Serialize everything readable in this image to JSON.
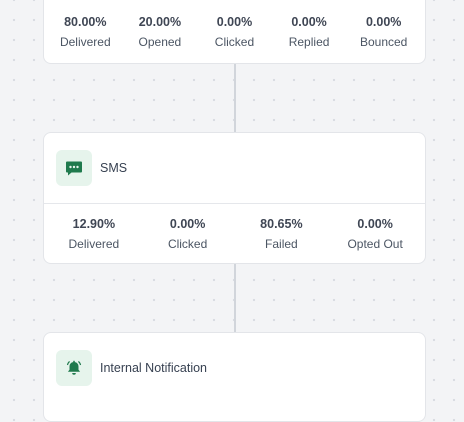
{
  "email_node": {
    "stats": [
      {
        "value": "80.00%",
        "label": "Delivered"
      },
      {
        "value": "20.00%",
        "label": "Opened"
      },
      {
        "value": "0.00%",
        "label": "Clicked"
      },
      {
        "value": "0.00%",
        "label": "Replied"
      },
      {
        "value": "0.00%",
        "label": "Bounced"
      }
    ]
  },
  "sms_node": {
    "title": "SMS",
    "icon": "sms-message-icon",
    "stats": [
      {
        "value": "12.90%",
        "label": "Delivered"
      },
      {
        "value": "0.00%",
        "label": "Clicked"
      },
      {
        "value": "80.65%",
        "label": "Failed"
      },
      {
        "value": "0.00%",
        "label": "Opted Out"
      }
    ]
  },
  "notification_node": {
    "title": "Internal Notification",
    "icon": "bell-icon"
  },
  "colors": {
    "accent": "#1f7a4d",
    "icon_bg": "#e6f4ec",
    "canvas": "#f3f4f6",
    "connector": "#d1d5db"
  }
}
